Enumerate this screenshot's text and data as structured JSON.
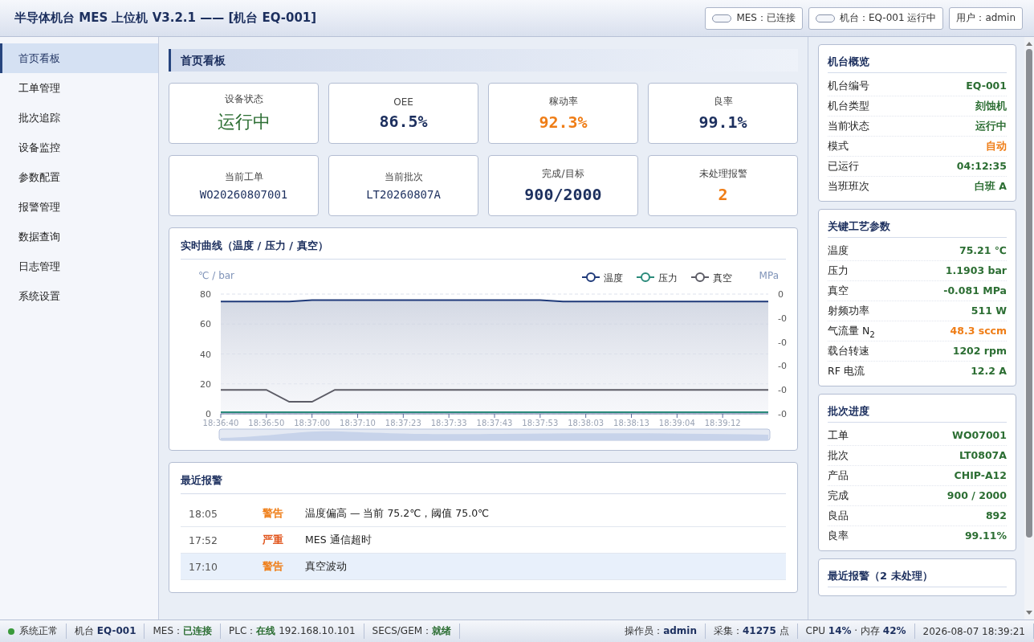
{
  "window": {
    "title": "半导体机台 MES 上位机 V3.2.1 —— [机台 EQ-001]"
  },
  "header_badges": [
    {
      "text": "MES：已连接",
      "indicator": true
    },
    {
      "text": "机台：EQ-001 运行中",
      "indicator": true
    },
    {
      "text": "用户：admin",
      "indicator": false
    }
  ],
  "sidebar": {
    "items": [
      {
        "label": "首页看板",
        "selected": true
      },
      {
        "label": "工单管理",
        "selected": false
      },
      {
        "label": "批次追踪",
        "selected": false
      },
      {
        "label": "设备监控",
        "selected": false
      },
      {
        "label": "参数配置",
        "selected": false
      },
      {
        "label": "报警管理",
        "selected": false
      },
      {
        "label": "数据查询",
        "selected": false
      },
      {
        "label": "日志管理",
        "selected": false
      },
      {
        "label": "系统设置",
        "selected": false
      }
    ]
  },
  "page_title": "首页看板",
  "kpis": [
    {
      "label": "设备状态",
      "value": "运行中",
      "kind": "status",
      "color": "#2c6e33"
    },
    {
      "label": "OEE",
      "value": "86.5%",
      "kind": "big",
      "color": "#1c2f5e"
    },
    {
      "label": "稼动率",
      "value": "92.3%",
      "kind": "big",
      "color": "#ef7d16"
    },
    {
      "label": "良率",
      "value": "99.1%",
      "kind": "big",
      "color": "#1c2f5e"
    },
    {
      "label": "当前工单",
      "value": "WO20260807001",
      "kind": "code",
      "color": "#1c2f5e"
    },
    {
      "label": "当前批次",
      "value": "LT20260807A",
      "kind": "code",
      "color": "#1c2f5e"
    },
    {
      "label": "完成/目标",
      "value": "900/2000",
      "kind": "big",
      "color": "#1c2f5e"
    },
    {
      "label": "未处理报警",
      "value": "2",
      "kind": "big",
      "color": "#ef7d16"
    }
  ],
  "chart_panel": {
    "chart_data": {
      "type": "line",
      "title": "实时曲线（温度 / 压力 / 真空）",
      "ylabel": "℃ / bar",
      "y2label": "MPa",
      "categories": [
        "18:36:40",
        null,
        "18:36:50",
        null,
        "18:37:00",
        null,
        "18:37:10",
        null,
        "18:37:23",
        null,
        "18:37:33",
        null,
        "18:37:43",
        null,
        "18:37:53",
        null,
        "18:38:03",
        null,
        "18:38:13",
        null,
        "18:39:04",
        null,
        "18:39:12",
        null,
        null
      ],
      "grid": true,
      "legend": true,
      "ylim": [
        0,
        80
      ],
      "yticks": [
        0,
        20,
        40,
        60,
        80
      ],
      "y2lim": [
        -0.1,
        0
      ],
      "y2ticks": [
        {
          "value": 0,
          "label": "0"
        },
        {
          "value": -0.02,
          "label": "-0"
        },
        {
          "value": -0.04,
          "label": "-0"
        },
        {
          "value": -0.06,
          "label": "-0"
        },
        {
          "value": -0.08,
          "label": "-0"
        },
        {
          "value": -0.1,
          "label": "-0"
        }
      ],
      "series": [
        {
          "name": "温度",
          "color": "#1f3a7a",
          "values": [
            75,
            75,
            75,
            75,
            76,
            76,
            76,
            76,
            76,
            76,
            76,
            76,
            76,
            76,
            76,
            75,
            75,
            75,
            75,
            75,
            75,
            75,
            75,
            75,
            75
          ]
        },
        {
          "name": "压力",
          "color": "#2a8a7a",
          "values": [
            1,
            1,
            1,
            1,
            1,
            1,
            1,
            1,
            1,
            1,
            1,
            1,
            1,
            1,
            1,
            1,
            1,
            1,
            1,
            1,
            1,
            1,
            1,
            1,
            1
          ]
        },
        {
          "name": "真空",
          "color": "#5c5c66",
          "axis": "y2",
          "values": [
            -0.08,
            -0.08,
            -0.08,
            -0.09,
            -0.09,
            -0.08,
            -0.08,
            -0.08,
            -0.08,
            -0.08,
            -0.08,
            -0.08,
            -0.08,
            -0.08,
            -0.08,
            -0.08,
            -0.08,
            -0.08,
            -0.08,
            -0.08,
            -0.08,
            -0.08,
            -0.08,
            -0.08,
            -0.08
          ]
        }
      ]
    }
  },
  "alarms": {
    "title": "最近报警",
    "rows": [
      {
        "time": "18:05",
        "level": "警告",
        "color": "#ef7d16",
        "message": "温度偏高 — 当前 75.2℃，阈值 75.0℃",
        "selected": false
      },
      {
        "time": "17:52",
        "level": "严重",
        "color": "#e0531a",
        "message": "MES 通信超时",
        "selected": false
      },
      {
        "time": "17:10",
        "level": "警告",
        "color": "#ef7d16",
        "message": "真空波动",
        "selected": true
      }
    ]
  },
  "right_cards": [
    {
      "title": "机台概览",
      "rows": [
        {
          "label": "机台编号",
          "value": "EQ-001",
          "color": "#2c6e33"
        },
        {
          "label": "机台类型",
          "value": "刻蚀机",
          "color": "#2c6e33"
        },
        {
          "label": "当前状态",
          "value": "运行中",
          "color": "#2c6e33"
        },
        {
          "label": "模式",
          "value": "自动",
          "color": "#ef7d16"
        },
        {
          "label": "已运行",
          "value": "04:12:35",
          "color": "#2c6e33"
        },
        {
          "label": "当班班次",
          "value": "白班 A",
          "color": "#2c6e33"
        }
      ]
    },
    {
      "title": "关键工艺参数",
      "rows": [
        {
          "label": "温度",
          "value": "75.21 ℃",
          "color": "#2c6e33"
        },
        {
          "label": "压力",
          "value": "1.1903 bar",
          "color": "#2c6e33"
        },
        {
          "label": "真空",
          "value": "-0.081 MPa",
          "color": "#2c6e33"
        },
        {
          "label": "射频功率",
          "value": "511 W",
          "color": "#2c6e33"
        },
        {
          "label": "气流量 N$_{2}$",
          "value": "48.3 sccm",
          "color": "#ef7d16"
        },
        {
          "label": "载台转速",
          "value": "1202 rpm",
          "color": "#2c6e33"
        },
        {
          "label": "RF 电流",
          "value": "12.2 A",
          "color": "#2c6e33"
        }
      ]
    },
    {
      "title": "批次进度",
      "rows": [
        {
          "label": "工单",
          "value": "WO07001",
          "color": "#2c6e33"
        },
        {
          "label": "批次",
          "value": "LT0807A",
          "color": "#2c6e33"
        },
        {
          "label": "产品",
          "value": "CHIP-A12",
          "color": "#2c6e33"
        },
        {
          "label": "完成",
          "value": "900 / 2000",
          "color": "#2c6e33"
        },
        {
          "label": "良品",
          "value": "892",
          "color": "#2c6e33"
        },
        {
          "label": "良率",
          "value": "99.11%",
          "color": "#2c6e33"
        }
      ]
    },
    {
      "title": "最近报警（2 未处理）"
    }
  ],
  "status_bar": {
    "left": [
      {
        "text": "系统正常",
        "color": "#3a9a3a"
      },
      {
        "text": "机台 **EQ-001**",
        "color": "#1c2f5e"
      },
      {
        "text": "MES：**已连接**",
        "color": "#2c6e33"
      },
      {
        "text": "PLC：**在线** 192.168.10.101",
        "color": "#2c6e33"
      },
      {
        "text": "SECS/GEM：**就绪**",
        "color": "#2c6e33"
      }
    ],
    "right": [
      {
        "text": "操作员：**admin**",
        "color": "#1c2f5e"
      },
      {
        "text": "采集：**41275** 点",
        "color": "#1c2f5e"
      },
      {
        "text": "CPU **14%** · 内存 **42%**",
        "color": "#1c2f5e"
      },
      {
        "text": "2026-08-07 18:39:21"
      }
    ]
  }
}
